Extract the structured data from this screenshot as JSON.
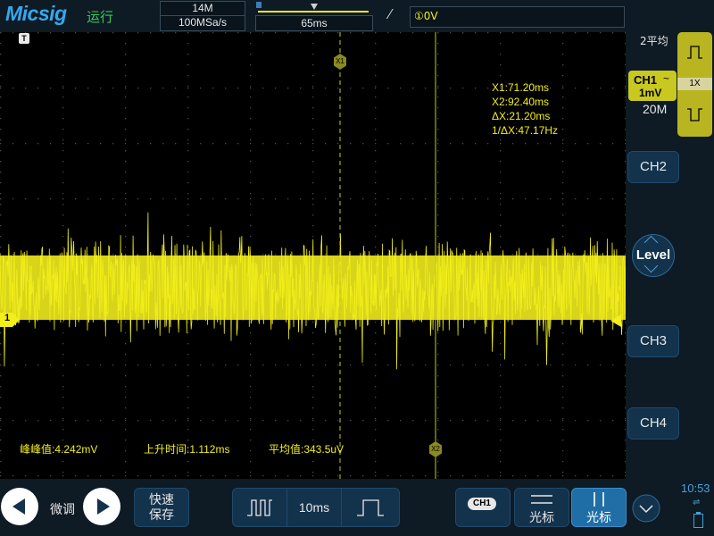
{
  "header": {
    "brand": "Micsig",
    "run_state": "运行",
    "memory_depth": "14M",
    "sample_rate": "100MSa/s",
    "time_position": "65ms",
    "trigger_slope_icon": "rising-edge-icon",
    "trigger_level": "①0V"
  },
  "cursors": {
    "x1_tag": "X1",
    "x2_tag": "X2",
    "x1": "X1:71.20ms",
    "x2": "X2:92.40ms",
    "dx": "ΔX:21.20ms",
    "inv_dx": "1/ΔX:47.17Hz"
  },
  "measurements": [
    {
      "text": "峰峰值:4.242mV"
    },
    {
      "text": "上升时间:1.112ms"
    },
    {
      "text": "平均值:343.5uV"
    }
  ],
  "channel1": {
    "marker": "1",
    "label": "CH1",
    "coupling_icon": "ac-coupling-icon",
    "scale": "1mV",
    "color": "#f2ee1a"
  },
  "acquisition": {
    "mode": "2平均"
  },
  "timebase": {
    "value": "20M"
  },
  "probe": {
    "ratio": "1X"
  },
  "channels": {
    "ch2": "CH2",
    "ch3": "CH3",
    "ch4": "CH4"
  },
  "level_button": "Level",
  "bottom": {
    "fine_label": "微调",
    "quick_save_1": "快速",
    "quick_save_2": "保存",
    "timebase": "10ms",
    "ch1_badge": "CH1",
    "cursor_h_label": "光标",
    "cursor_v_label": "光标",
    "clock": "10:53"
  }
}
